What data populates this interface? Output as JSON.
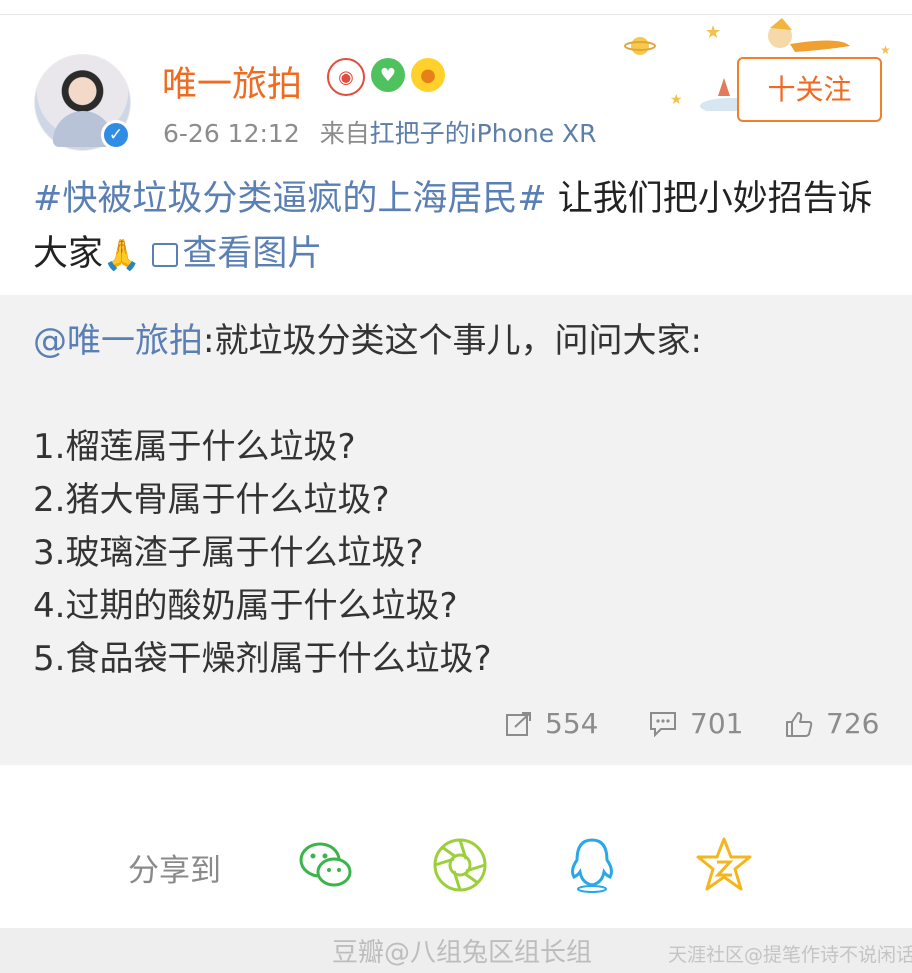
{
  "post": {
    "username": "唯一旅拍",
    "time": "6-26 12:12",
    "source_prefix": "来自",
    "source": "扛把子的iPhone XR",
    "follow_label": "十关注",
    "topic": "#快被垃圾分类逼疯的上海居民#",
    "text": " 让我们把小妙招告诉大家",
    "view_pictures": "查看图片"
  },
  "retweet": {
    "mention": "@唯一旅拍",
    "intro": ":就垃圾分类这个事儿，问问大家:",
    "questions": [
      "1.榴莲属于什么垃圾?",
      "2.猪大骨属于什么垃圾?",
      "3.玻璃渣子属于什么垃圾?",
      "4.过期的酸奶属于什么垃圾?",
      "5.食品袋干燥剂属于什么垃圾?"
    ],
    "reposts": "554",
    "comments": "701",
    "likes": "726"
  },
  "share": {
    "label": "分享到",
    "targets": [
      "wechat",
      "moments",
      "qq",
      "qzone"
    ]
  },
  "watermarks": {
    "left": "豆瓣@八组兔区组长组",
    "right": "天涯社区@提笔作诗不说闲话"
  },
  "colors": {
    "accent_orange": "#f06a1f",
    "link_blue": "#5a7fb4",
    "verified_blue": "#2f8de4",
    "share_green": "#3bb54a"
  }
}
